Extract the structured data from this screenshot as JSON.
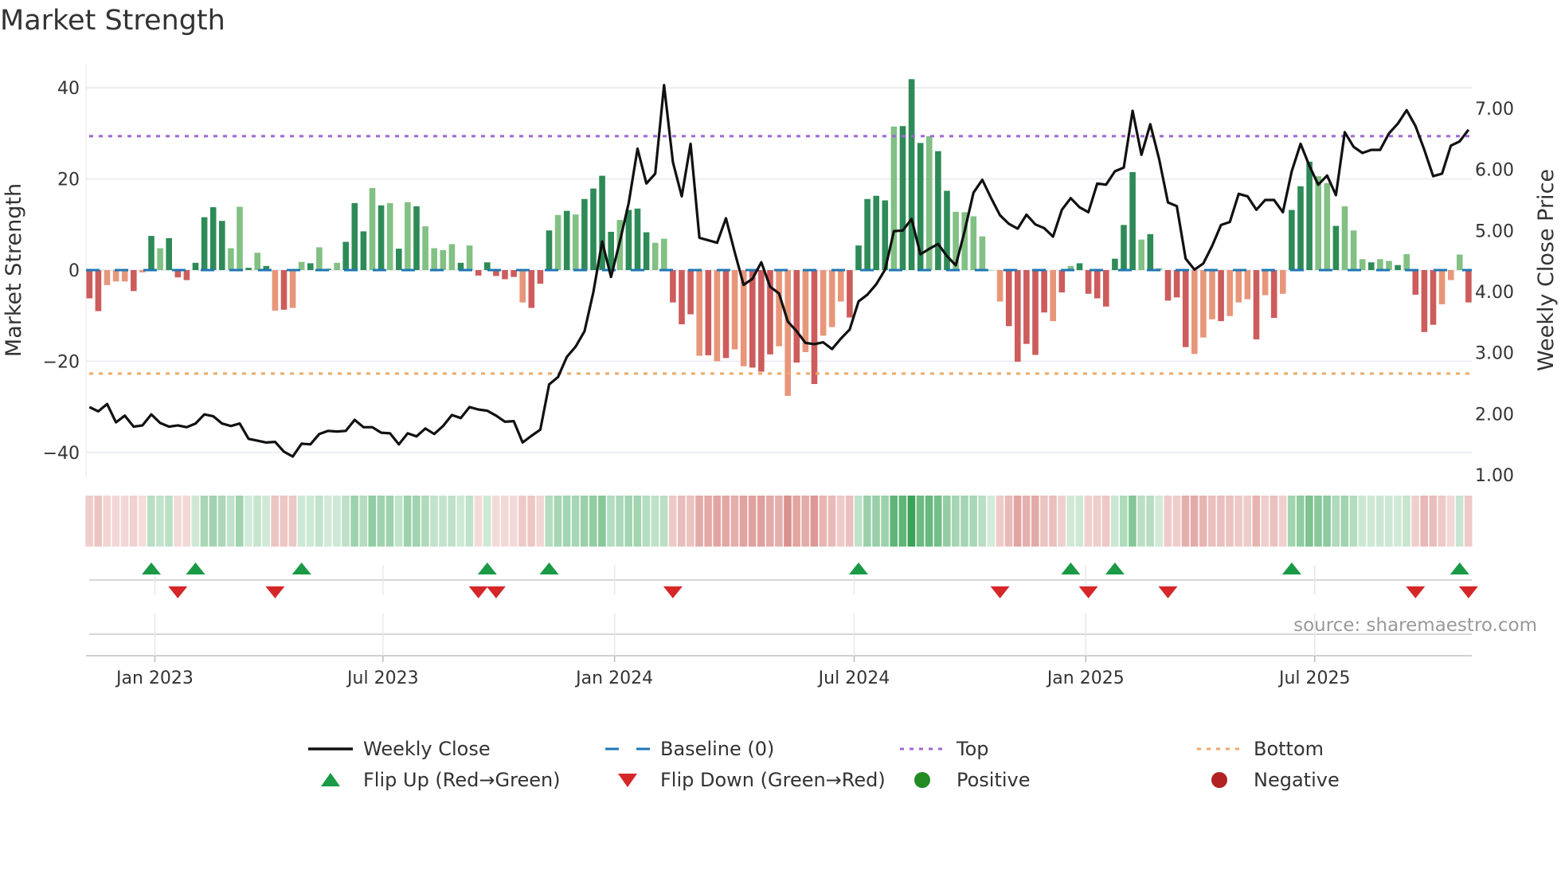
{
  "chart_data": {
    "type": "bar",
    "title": "Market Strength",
    "ylabel": "Market Strength",
    "y2label": "Weekly Close Price",
    "ylim": [
      -45,
      44
    ],
    "y2lim": [
      1.0,
      7.6
    ],
    "yticks": [
      "40",
      "20",
      "0",
      "−20",
      "−40"
    ],
    "ytick_values": [
      40,
      20,
      0,
      -20,
      -40
    ],
    "y2ticks": [
      "7.00",
      "6.00",
      "5.00",
      "4.00",
      "3.00",
      "2.00",
      "1.00"
    ],
    "y2tick_values": [
      7,
      6,
      5,
      4,
      3,
      2,
      1
    ],
    "xticks": [
      {
        "label": "Jan 2023",
        "week": 8.4
      },
      {
        "label": "Jul 2023",
        "week": 34.2
      },
      {
        "label": "Jan 2024",
        "week": 60.4
      },
      {
        "label": "Jul 2024",
        "week": 87.5
      },
      {
        "label": "Jan 2025",
        "week": 113.7
      },
      {
        "label": "Jul 2025",
        "week": 139.6
      }
    ],
    "top_level": 29.4,
    "bottom_level": -22.7,
    "baseline": 0,
    "grid": true,
    "legend_position": "bottom",
    "strength": [
      -6.2,
      -9,
      -3.3,
      -2.5,
      -2.5,
      -4.6,
      -0.5,
      7.5,
      4.8,
      7,
      -1.6,
      -2.2,
      1.6,
      11.6,
      13.8,
      10.8,
      4.8,
      13.9,
      0.5,
      3.8,
      0.9,
      -8.9,
      -8.7,
      -8.3,
      1.8,
      1.5,
      5,
      0.3,
      1.6,
      6.2,
      14.7,
      8.5,
      18,
      14.2,
      14.7,
      4.7,
      14.9,
      14,
      9.6,
      4.8,
      4.4,
      5.7,
      1.6,
      5.4,
      -1.2,
      1.7,
      -1.3,
      -2,
      -1.5,
      -7.1,
      -8.3,
      -3,
      8.7,
      12.1,
      13,
      12.2,
      15.6,
      17.9,
      20.7,
      8.4,
      11,
      13.2,
      13.5,
      8.3,
      6,
      6.9,
      -7.1,
      -11.9,
      -9.7,
      -18.8,
      -18.7,
      -20,
      -19.3,
      -17.4,
      -21.1,
      -21.4,
      -22.3,
      -18.5,
      -16.7,
      -27.6,
      -20.3,
      -18,
      -25,
      -14.4,
      -12.5,
      -6.9,
      -10.4,
      5.4,
      15.6,
      16.3,
      15.3,
      31.5,
      31.6,
      41.9,
      27.9,
      29.4,
      26.1,
      17.4,
      12.8,
      12.7,
      11.8,
      7.4,
      0,
      -6.9,
      -12.3,
      -20.1,
      -16.2,
      -18.6,
      -9.3,
      -11.2,
      -4.9,
      0.9,
      1.5,
      -5.2,
      -6.2,
      -8,
      2.5,
      9.9,
      21.5,
      6.7,
      7.9,
      0.4,
      -6.7,
      -6,
      -16.9,
      -18.4,
      -14.8,
      -10.8,
      -11.2,
      -10.1,
      -7.1,
      -6.4,
      -15.2,
      -5.5,
      -10.5,
      -5.2,
      13.2,
      18.4,
      23.8,
      20.6,
      19.1,
      9.7,
      14,
      8.7,
      2.4,
      1.7,
      2.4,
      2,
      1.1,
      3.5,
      -5.4,
      -13.6,
      -12,
      -7.5,
      -2.2,
      3.4,
      -7.1
    ],
    "shade": "ddllldldldddddddlldldldlldldldddldldldlllldldddddldddldlddddldddlldddldldlldddlldldllldddddldddlddlllllldddddldldddddddldldddllldllldldldddlldllldlldldddllldd",
    "weekly_close": [
      2.11,
      2.04,
      2.16,
      1.86,
      1.97,
      1.79,
      1.81,
      1.99,
      1.85,
      1.79,
      1.81,
      1.78,
      1.84,
      1.99,
      1.96,
      1.84,
      1.8,
      1.84,
      1.59,
      1.56,
      1.53,
      1.54,
      1.38,
      1.3,
      1.51,
      1.5,
      1.67,
      1.72,
      1.71,
      1.72,
      1.9,
      1.78,
      1.78,
      1.69,
      1.68,
      1.5,
      1.68,
      1.63,
      1.76,
      1.67,
      1.8,
      1.98,
      1.93,
      2.11,
      2.07,
      2.05,
      1.97,
      1.87,
      1.88,
      1.53,
      1.64,
      1.74,
      2.48,
      2.6,
      2.93,
      3.1,
      3.35,
      3.99,
      4.82,
      4.24,
      4.82,
      5.45,
      6.34,
      5.77,
      5.93,
      7.38,
      6.12,
      5.56,
      6.42,
      4.88,
      4.84,
      4.8,
      5.2,
      4.64,
      4.11,
      4.21,
      4.48,
      4.08,
      3.97,
      3.51,
      3.35,
      3.16,
      3.14,
      3.17,
      3.06,
      3.23,
      3.38,
      3.84,
      3.95,
      4.12,
      4.36,
      4.99,
      5.0,
      5.19,
      4.61,
      4.7,
      4.78,
      4.58,
      4.43,
      4.99,
      5.62,
      5.83,
      5.53,
      5.25,
      5.11,
      5.03,
      5.26,
      5.1,
      5.04,
      4.9,
      5.34,
      5.53,
      5.38,
      5.3,
      5.77,
      5.75,
      5.97,
      6.03,
      6.96,
      6.24,
      6.74,
      6.17,
      5.46,
      5.4,
      4.54,
      4.36,
      4.46,
      4.75,
      5.09,
      5.14,
      5.6,
      5.56,
      5.34,
      5.5,
      5.5,
      5.3,
      5.97,
      6.42,
      6.06,
      5.75,
      5.9,
      5.58,
      6.61,
      6.37,
      6.27,
      6.32,
      6.32,
      6.59,
      6.75,
      6.97,
      6.71,
      6.32,
      5.89,
      5.93,
      6.39,
      6.46,
      6.65
    ],
    "flip_up_weeks": [
      8,
      13,
      25,
      46,
      53,
      88,
      112,
      117,
      137,
      156
    ],
    "flip_down_weeks": [
      11,
      22,
      45,
      47,
      67,
      104,
      114,
      123,
      151,
      157
    ],
    "legend": [
      {
        "label": "Weekly Close",
        "symbol": "line",
        "color": "#111111"
      },
      {
        "label": "Baseline (0)",
        "symbol": "dash",
        "color": "#1f77b4"
      },
      {
        "label": "Top",
        "symbol": "dot",
        "color": "#a066d8"
      },
      {
        "label": "Bottom",
        "symbol": "dot",
        "color": "#f0a868"
      },
      {
        "label": "Flip Up (Red→Green)",
        "symbol": "tri-up",
        "color": "#1a9a46"
      },
      {
        "label": "Flip Down (Green→Red)",
        "symbol": "tri-down",
        "color": "#d62728"
      },
      {
        "label": "Positive",
        "symbol": "circle",
        "color": "#228b22"
      },
      {
        "label": "Negative",
        "symbol": "circle",
        "color": "#b22222"
      }
    ],
    "source": "source: sharemaestro.com"
  },
  "colors": {
    "pos_dark": "#2e8b57",
    "pos_light": "#82c084",
    "neg_dark": "#cd5c5c",
    "neg_light": "#e8967a",
    "grid": "#eceef2"
  }
}
